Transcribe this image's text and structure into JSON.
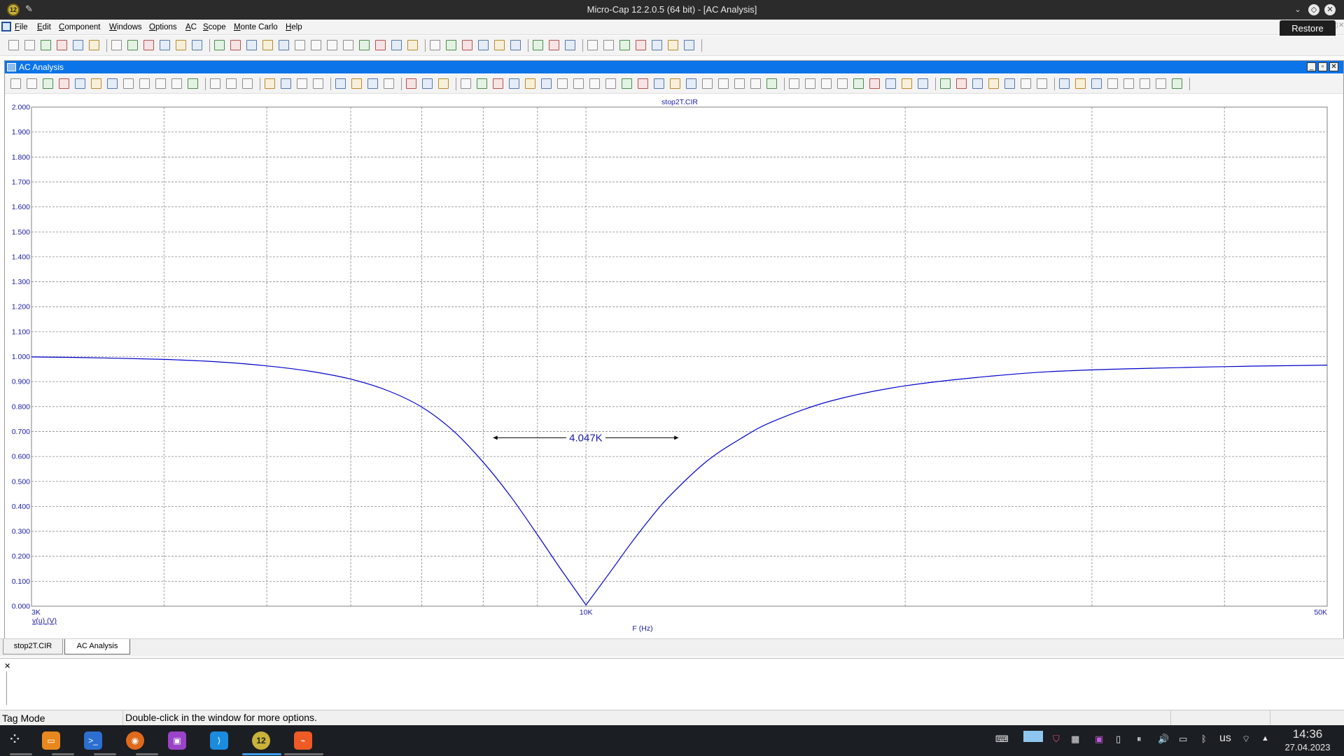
{
  "window": {
    "title": "Micro-Cap 12.2.0.5 (64 bit) - [AC Analysis]",
    "tooltip": "Restore"
  },
  "menu": [
    "File",
    "Edit",
    "Component",
    "Windows",
    "Options",
    "AC",
    "Scope",
    "Monte Carlo",
    "Help"
  ],
  "child_window": {
    "title": "AC Analysis"
  },
  "chart_data": {
    "type": "line",
    "title": "stop2T.CIR",
    "xlabel": "F (Hz)",
    "ylabel": "v(u) (V)",
    "x_scale": "log",
    "xlim": [
      3000,
      50000
    ],
    "ylim": [
      0,
      2
    ],
    "x_tick_labels": [
      "3K",
      "10K",
      "50K"
    ],
    "y_tick_labels": [
      "0.000",
      "0.100",
      "0.200",
      "0.300",
      "0.400",
      "0.500",
      "0.600",
      "0.700",
      "0.800",
      "0.900",
      "1.000",
      "1.100",
      "1.200",
      "1.300",
      "1.400",
      "1.500",
      "1.600",
      "1.700",
      "1.800",
      "1.900",
      "2.000"
    ],
    "grid": true,
    "series": [
      {
        "name": "v(u) (V)",
        "color": "#0000cc",
        "x": [
          3000,
          3500,
          4000,
          4500,
          5000,
          5500,
          6000,
          6500,
          7000,
          7500,
          8000,
          8500,
          9000,
          9500,
          10000,
          10500,
          11000,
          11500,
          12000,
          13000,
          14000,
          15000,
          17000,
          20000,
          25000,
          30000,
          40000,
          50000
        ],
        "y": [
          0.999,
          0.995,
          0.989,
          0.979,
          0.963,
          0.941,
          0.91,
          0.864,
          0.798,
          0.702,
          0.577,
          0.437,
          0.286,
          0.139,
          0.005,
          0.127,
          0.246,
          0.352,
          0.443,
          0.581,
          0.672,
          0.74,
          0.822,
          0.883,
          0.928,
          0.947,
          0.96,
          0.966
        ]
      }
    ],
    "annotation": {
      "label": "4.047K",
      "x_start": 8176,
      "x_end": 12223,
      "y": 0.675
    }
  },
  "tabs": [
    "stop2T.CIR",
    "AC Analysis"
  ],
  "status": {
    "mode": "Tag Mode",
    "hint": "Double-click in the window for more options."
  },
  "taskbar": {
    "keyboard": "us",
    "time": "14:36",
    "date": "27.04.2023"
  }
}
